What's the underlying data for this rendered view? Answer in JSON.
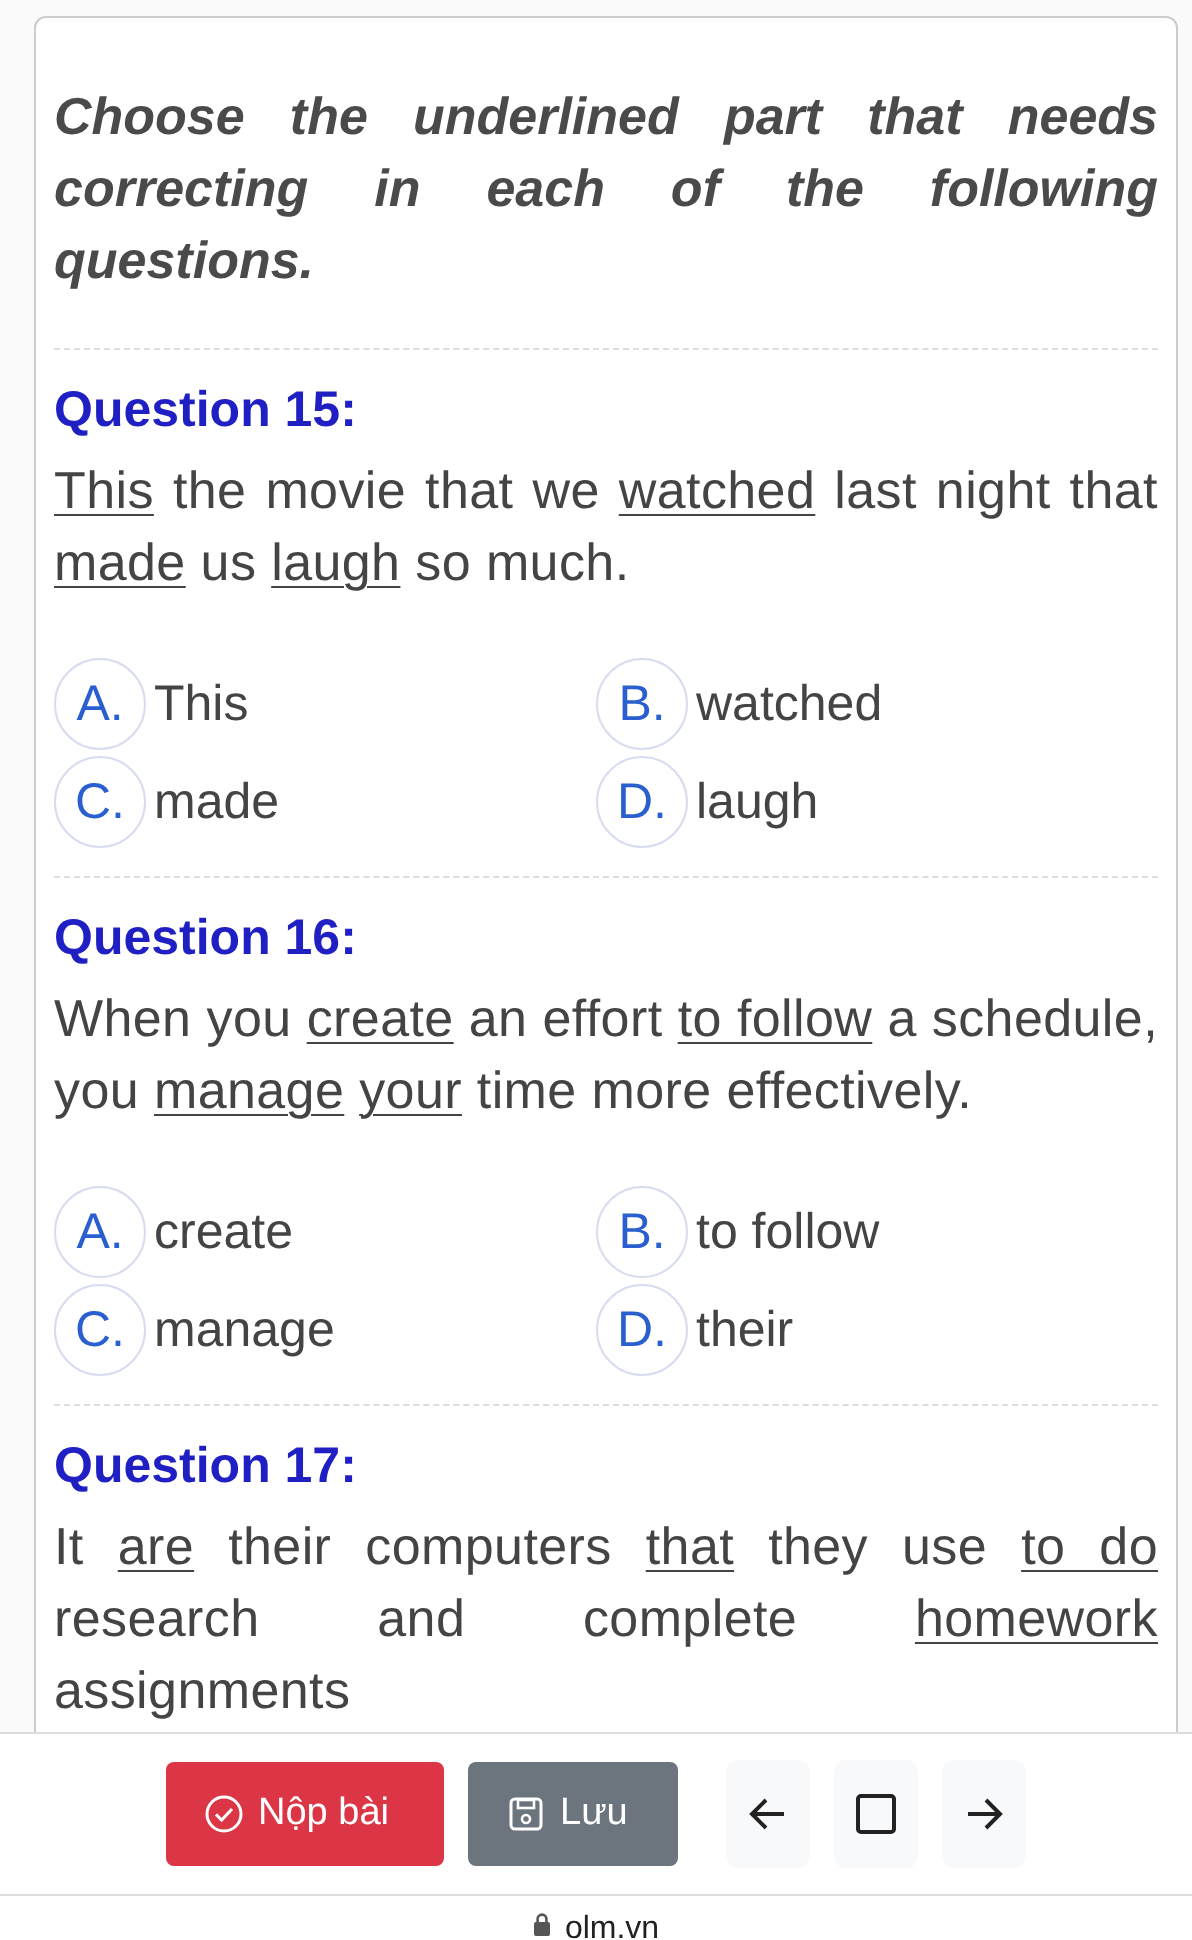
{
  "instruction": "Choose the underlined part that needs correcting in each of the following questions.",
  "questions": [
    {
      "title": "Question 15:",
      "segments": [
        {
          "text": "This",
          "underlined": true
        },
        {
          "text": "the movie that we",
          "underlined": false
        },
        {
          "text": "watched",
          "underlined": true
        },
        {
          "text": "last night that",
          "underlined": false
        },
        {
          "text": "made",
          "underlined": true
        },
        {
          "text": "us",
          "underlined": false
        },
        {
          "text": "laugh",
          "underlined": true
        },
        {
          "text": "so much.",
          "underlined": false
        }
      ],
      "options": [
        {
          "letter": "A.",
          "text": "This"
        },
        {
          "letter": "B.",
          "text": "watched"
        },
        {
          "letter": "C.",
          "text": "made"
        },
        {
          "letter": "D.",
          "text": "laugh"
        }
      ]
    },
    {
      "title": "Question 16:",
      "segments": [
        {
          "text": "When you",
          "underlined": false
        },
        {
          "text": "create",
          "underlined": true
        },
        {
          "text": "an effort",
          "underlined": false
        },
        {
          "text": "to follow",
          "underlined": true
        },
        {
          "text": "a schedule, you",
          "underlined": false
        },
        {
          "text": "manage",
          "underlined": true
        },
        {
          "text": "your",
          "underlined": true
        },
        {
          "text": "time more effectively.",
          "underlined": false
        }
      ],
      "options": [
        {
          "letter": "A.",
          "text": "create"
        },
        {
          "letter": "B.",
          "text": "to follow"
        },
        {
          "letter": "C.",
          "text": "manage"
        },
        {
          "letter": "D.",
          "text": "their"
        }
      ]
    },
    {
      "title": "Question 17:",
      "segments": [
        {
          "text": "It",
          "underlined": false
        },
        {
          "text": "are",
          "underlined": true
        },
        {
          "text": "their computers",
          "underlined": false
        },
        {
          "text": "that",
          "underlined": true
        },
        {
          "text": "they use",
          "underlined": false
        },
        {
          "text": "to do",
          "underlined": true
        },
        {
          "text": "research and complete",
          "underlined": false
        },
        {
          "text": "homework",
          "underlined": true
        },
        {
          "text": "assignments",
          "underlined": false
        }
      ]
    }
  ],
  "toolbar": {
    "submit": "Nộp bài",
    "save": "Lưu"
  },
  "address_bar": {
    "url": "olm.vn"
  }
}
